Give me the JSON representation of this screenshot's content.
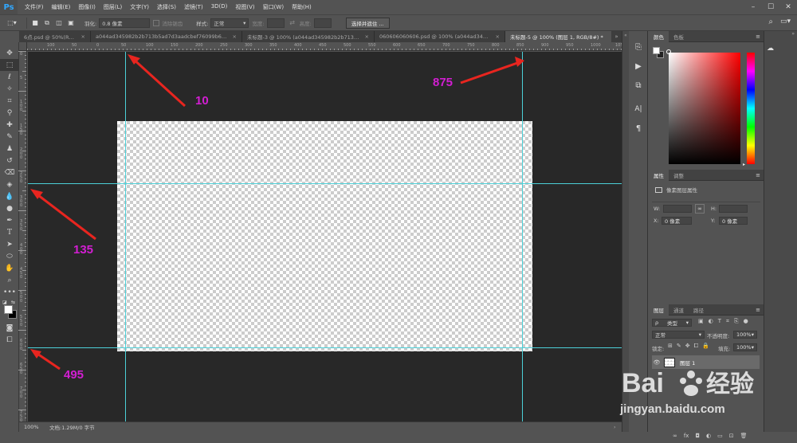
{
  "app": {
    "logo": "Ps"
  },
  "menu": [
    "文件(F)",
    "编辑(E)",
    "图像(I)",
    "图层(L)",
    "文字(Y)",
    "选择(S)",
    "滤镜(T)",
    "3D(D)",
    "视图(V)",
    "窗口(W)",
    "帮助(H)"
  ],
  "options": {
    "feather_label": "羽化:",
    "feather_value": "0.8 像素",
    "antialias_label": "消除锯齿",
    "style_label": "样式:",
    "style_value": "正常",
    "width_label": "宽度:",
    "height_label": "高度:",
    "select_mask_button": "选择并遮住 ..."
  },
  "tabs": [
    {
      "label": "6点.psd @ 50%(RGB...",
      "close": "×"
    },
    {
      "label": "a044ad345982b2b713b5ad7d3aadcbef76099b65.jpg",
      "close": "×"
    },
    {
      "label": "未标题-3 @ 100% (a044ad345982b2b713b...",
      "close": "×"
    },
    {
      "label": "060606060606.psd @ 100% (a044ad34598...",
      "close": "×"
    },
    {
      "label": "未标题-5 @ 100% (图层 1, RGB/8#) *",
      "close": "×"
    }
  ],
  "ruler_top_numbers": [
    "100",
    "50",
    "0",
    "50",
    "100",
    "150",
    "200",
    "250",
    "300",
    "350",
    "400",
    "450",
    "500",
    "550",
    "600",
    "650",
    "700",
    "750",
    "800",
    "850",
    "900",
    "950",
    "1000",
    "1050"
  ],
  "ruler_left_numbers": [
    "0",
    "5",
    "1 0 0",
    "1 5 0",
    "2 0 0",
    "2 5 0",
    "3 0 0",
    "3 5 0",
    "4 0 0",
    "4 5 0",
    "5 0 0",
    "5 5 0",
    "6 0 0",
    "6 5 0",
    "7 0 0",
    "7 5 0"
  ],
  "annotations": {
    "guide_top_left": "10",
    "guide_top_right": "875",
    "guide_left_upper": "135",
    "guide_left_lower": "495"
  },
  "status": {
    "zoom": "100%",
    "doc": "文档:1.29M/0 字节"
  },
  "color_panel": {
    "tabs": [
      "颜色",
      "色板"
    ]
  },
  "properties_panel": {
    "tabs": [
      "属性",
      "调整"
    ],
    "title": "像素图层属性",
    "w_label": "W:",
    "h_label": "H:",
    "x_label": "X:",
    "x_value": "0 像素",
    "y_label": "Y:",
    "y_value": "0 像素"
  },
  "layers_panel": {
    "tabs": [
      "图层",
      "通道",
      "路径"
    ],
    "filter_type": "类型",
    "blend_mode": "正常",
    "opacity_label": "不透明度:",
    "opacity_value": "100%",
    "lock_label": "锁定:",
    "fill_label": "填充:",
    "fill_value": "100%",
    "layer_name": "图层 1"
  },
  "watermark": {
    "brand": "Bai",
    "brand2": "经验",
    "url": "jingyan.baidu.com"
  },
  "colors": {
    "guide": "#4cd0d8",
    "annotation": "#d21ed2",
    "arrow": "#e8251f",
    "canvas_bg": "#282828",
    "ui_bg": "#535353"
  }
}
